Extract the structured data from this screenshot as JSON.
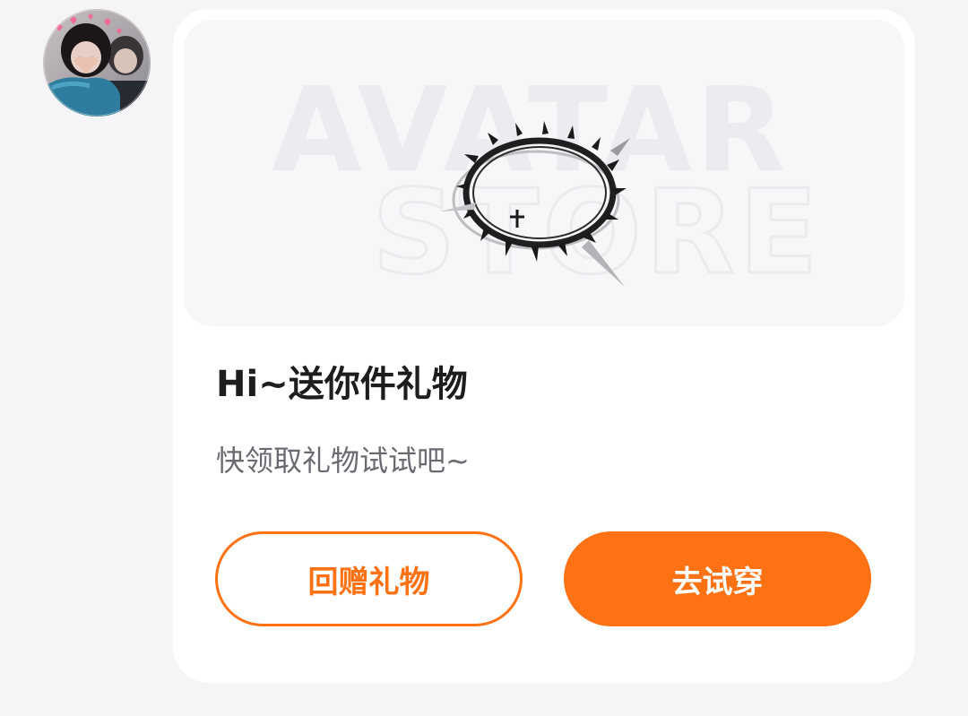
{
  "sender": {
    "avatar_icon": "user-avatar-photo"
  },
  "gift_card": {
    "banner": {
      "watermark_line1": "AVATAR",
      "watermark_line2": "STORE",
      "item_icon": "spiked-ring-accessory-icon"
    },
    "title": "Hi~送你件礼物",
    "subtitle": "快领取礼物试试吧~",
    "buttons": {
      "return_gift": "回赠礼物",
      "try_on": "去试穿"
    }
  },
  "colors": {
    "accent": "#ff7214",
    "page_bg": "#f5f5f7",
    "card_bg": "#ffffff",
    "banner_bg": "#f6f7f9",
    "title": "#1d1d1f",
    "subtitle": "#6a6a72"
  }
}
